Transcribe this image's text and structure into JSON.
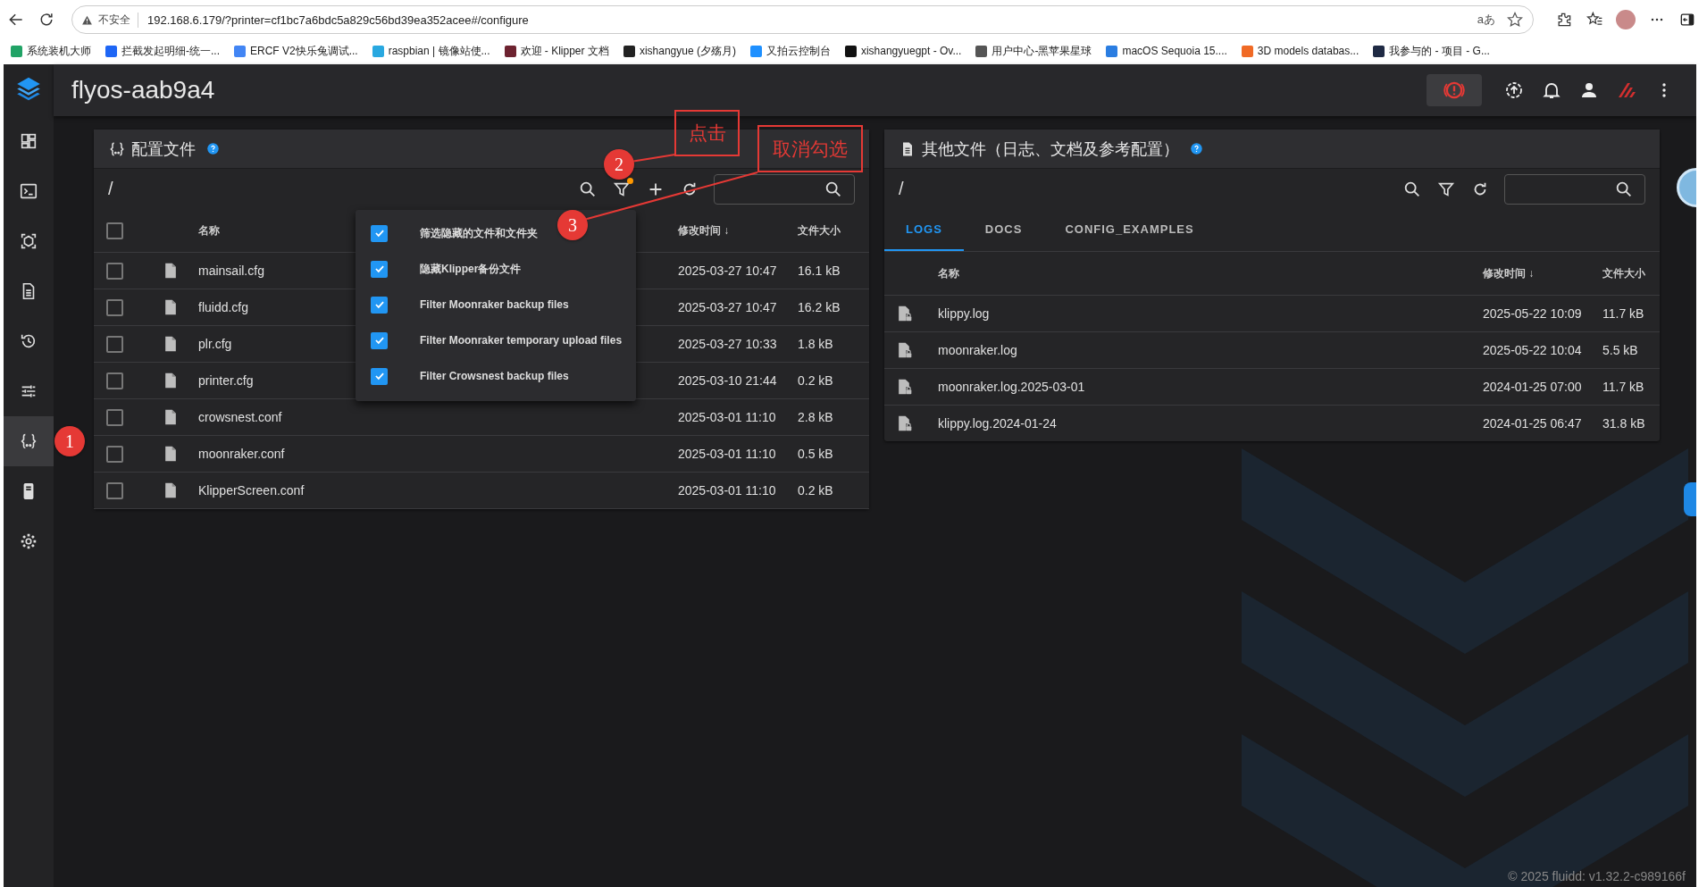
{
  "browser": {
    "security_label": "不安全",
    "url": "192.168.6.179/?printer=cf1bc7a6bdc5a829c56bd39ea352acee#/configure",
    "translate_label": "aあ",
    "bookmarks": [
      {
        "label": "系统装机大师",
        "color": "#21a366"
      },
      {
        "label": "拦截发起明细-统一...",
        "color": "#1e66f5"
      },
      {
        "label": "ERCF V2快乐兔调试...",
        "color": "#4285f4"
      },
      {
        "label": "raspbian | 镜像站使...",
        "color": "#29a8e0"
      },
      {
        "label": "欢迎 - Klipper 文档",
        "color": "#6d2330"
      },
      {
        "label": "xishangyue (夕殇月)",
        "color": "#222222"
      },
      {
        "label": "又拍云控制台",
        "color": "#1e90ff"
      },
      {
        "label": "xishangyuegpt - Ov...",
        "color": "#111111"
      },
      {
        "label": "用户中心-黑苹果星球",
        "color": "#555555"
      },
      {
        "label": "macOS Sequoia 15....",
        "color": "#2a7de1"
      },
      {
        "label": "3D models databas...",
        "color": "#f06a25"
      },
      {
        "label": "我参与的 - 项目 - G...",
        "color": "#1f2a44"
      }
    ]
  },
  "app": {
    "title": "flyos-aab9a4"
  },
  "sidebar": [
    {
      "kind": "dashboard",
      "selected": false
    },
    {
      "kind": "console",
      "selected": false
    },
    {
      "kind": "cube",
      "selected": false
    },
    {
      "kind": "document",
      "selected": false
    },
    {
      "kind": "history",
      "selected": false
    },
    {
      "kind": "tune",
      "selected": false
    },
    {
      "kind": "braces",
      "selected": true
    },
    {
      "kind": "device",
      "selected": false
    },
    {
      "kind": "gear",
      "selected": false
    }
  ],
  "config_panel": {
    "title": "配置文件",
    "path": "/",
    "filter_active": true,
    "select_all_checked": false,
    "columns": [
      "名称",
      "修改时间 ↓",
      "文件大小"
    ],
    "files": [
      {
        "name": "mainsail.cfg",
        "modified": "2025-03-27 10:47",
        "size": "16.1 kB",
        "checked": false
      },
      {
        "name": "fluidd.cfg",
        "modified": "2025-03-27 10:47",
        "size": "16.2 kB",
        "checked": false
      },
      {
        "name": "plr.cfg",
        "modified": "2025-03-27 10:33",
        "size": "1.8 kB",
        "checked": false
      },
      {
        "name": "printer.cfg",
        "modified": "2025-03-10 21:44",
        "size": "0.2 kB",
        "checked": false
      },
      {
        "name": "crowsnest.conf",
        "modified": "2025-03-01 11:10",
        "size": "2.8 kB",
        "checked": false
      },
      {
        "name": "moonraker.conf",
        "modified": "2025-03-01 11:10",
        "size": "0.5 kB",
        "checked": false
      },
      {
        "name": "KlipperScreen.conf",
        "modified": "2025-03-01 11:10",
        "size": "0.2 kB",
        "checked": false
      }
    ],
    "filter_menu": [
      {
        "label": "筛选隐藏的文件和文件夹",
        "checked": true
      },
      {
        "label": "隐藏Klipper备份文件",
        "checked": true
      },
      {
        "label": "Filter Moonraker backup files",
        "checked": true
      },
      {
        "label": "Filter Moonraker temporary upload files",
        "checked": true
      },
      {
        "label": "Filter Crowsnest backup files",
        "checked": true
      }
    ]
  },
  "other_panel": {
    "title": "其他文件（日志、文档及参考配置）",
    "path": "/",
    "tabs": [
      {
        "label": "LOGS",
        "selected": true
      },
      {
        "label": "DOCS",
        "selected": false
      },
      {
        "label": "CONFIG_EXAMPLES",
        "selected": false
      }
    ],
    "columns": [
      "名称",
      "修改时间 ↓",
      "文件大小"
    ],
    "files": [
      {
        "name": "klippy.log",
        "modified": "2025-05-22 10:09",
        "size": "11.7 kB"
      },
      {
        "name": "moonraker.log",
        "modified": "2025-05-22 10:04",
        "size": "5.5 kB"
      },
      {
        "name": "moonraker.log.2025-03-01",
        "modified": "2024-01-25 07:00",
        "size": "11.7 kB"
      },
      {
        "name": "klippy.log.2024-01-24",
        "modified": "2024-01-25 06:47",
        "size": "31.8 kB"
      }
    ]
  },
  "footer": "© 2025 fluidd: v1.32.2-c989166f",
  "annotations": {
    "steps": [
      "1",
      "2",
      "3"
    ],
    "notes": [
      "点击",
      "取消勾选"
    ]
  }
}
